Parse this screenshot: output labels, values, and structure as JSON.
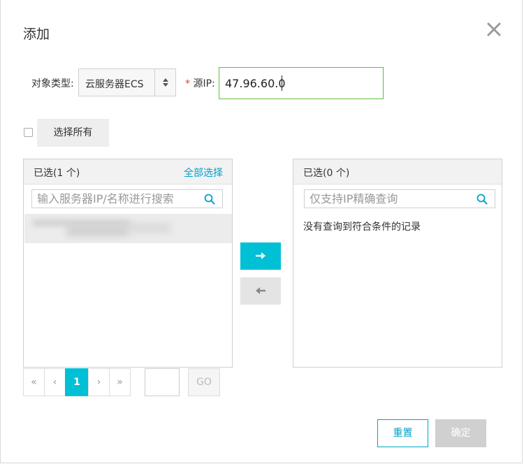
{
  "dialog": {
    "title": "添加",
    "close_icon": "close-icon"
  },
  "form": {
    "object_type_label": "对象类型:",
    "object_type_value": "云服务器ECS",
    "source_ip_required": "*",
    "source_ip_label": "源IP:",
    "source_ip_value": "47.96.60.0"
  },
  "select_all": {
    "label": "选择所有",
    "checked": false
  },
  "left_panel": {
    "header": "已选(1 个)",
    "select_all_link": "全部选择",
    "search_placeholder": "输入服务器IP/名称进行搜索",
    "search_icon": "search-icon"
  },
  "right_panel": {
    "header": "已选(0 个)",
    "search_placeholder": "仅支持IP精确查询",
    "search_icon": "search-icon",
    "empty_text": "没有查询到符合条件的记录"
  },
  "transfer": {
    "move_right_icon": "arrow-right-icon",
    "move_left_icon": "arrow-left-icon"
  },
  "pagination": {
    "first": "«",
    "prev": "‹",
    "current": "1",
    "next": "›",
    "last": "»",
    "go_label": "GO"
  },
  "footer": {
    "reset_label": "重置",
    "confirm_label": "确定"
  },
  "colors": {
    "accent": "#00c0d6",
    "link": "#00a2ca",
    "focus_border": "#5fbf3e",
    "required": "#e4393c"
  }
}
